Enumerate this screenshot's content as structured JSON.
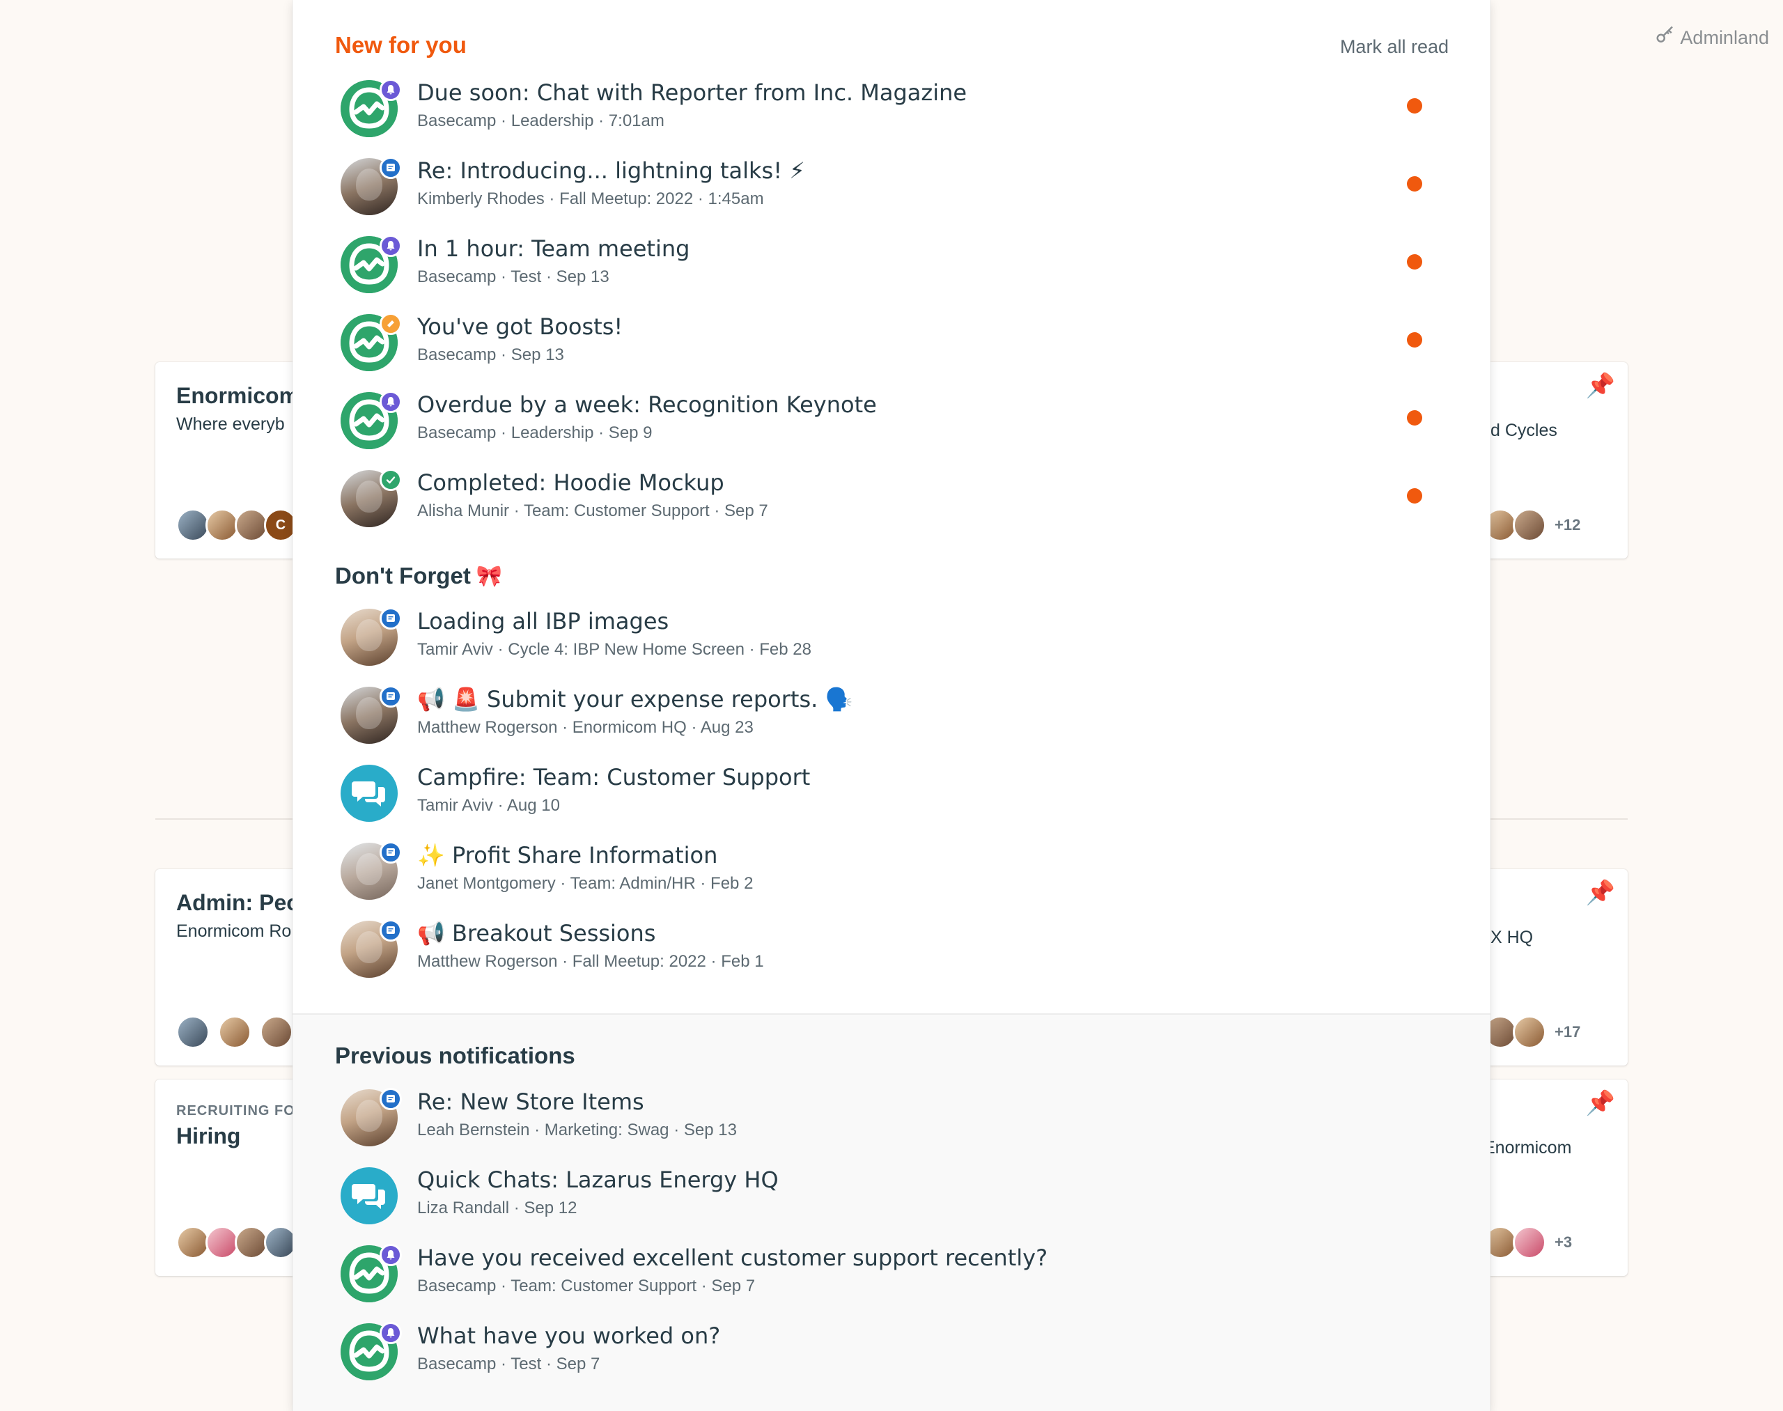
{
  "adminland": {
    "label": "Adminland",
    "icon": "key-icon"
  },
  "background_cards": {
    "card1": {
      "title": "Enormicom",
      "desc": "Where everyb",
      "avatar_initials": "C"
    },
    "card2": {
      "desc": "d Cycles",
      "extra": "+12"
    },
    "card3": {
      "title": "Admin: Peo",
      "desc": "Enormicom Ro"
    },
    "card4": {
      "desc": "X HQ",
      "extra": "+17"
    },
    "card5": {
      "eyebrow": "RECRUITING FO",
      "title": "Hiring"
    },
    "card6": {
      "desc": "Enormicom",
      "extra": "+3"
    }
  },
  "panel": {
    "new_heading": "New for you",
    "mark_all_read": "Mark all read",
    "new_items": [
      {
        "title": "Due soon: Chat with Reporter from Inc. Magazine",
        "meta": "Basecamp · Leadership · 7:01am",
        "avatar": "basecamp",
        "badge": "bell-icon",
        "unread": true
      },
      {
        "title": "Re: Introducing... lightning talks! ⚡",
        "meta": "Kimberly Rhodes · Fall Meetup: 2022 · 1:45am",
        "avatar": "person",
        "badge": "message-icon",
        "unread": true
      },
      {
        "title": "In 1 hour: Team meeting",
        "meta": "Basecamp · Test · Sep 13",
        "avatar": "basecamp",
        "badge": "bell-icon",
        "unread": true
      },
      {
        "title": "You've got Boosts!",
        "meta": "Basecamp · Sep 13",
        "avatar": "basecamp",
        "badge": "boost-icon",
        "unread": true
      },
      {
        "title": "Overdue by a week: Recognition Keynote",
        "meta": "Basecamp · Leadership · Sep 9",
        "avatar": "basecamp",
        "badge": "bell-icon",
        "unread": true
      },
      {
        "title": "Completed: Hoodie Mockup",
        "meta": "Alisha Munir · Team: Customer Support · Sep 7",
        "avatar": "person",
        "badge": "check-icon",
        "unread": true
      }
    ],
    "dont_forget_heading": "Don't Forget",
    "dont_forget_items": [
      {
        "title": "Loading all IBP images",
        "meta": "Tamir Aviv · Cycle 4: IBP New Home Screen · Feb 28",
        "avatar": "person",
        "badge": "message-icon"
      },
      {
        "title": "📢 🚨 Submit your expense reports. 🗣️",
        "meta": "Matthew Rogerson · Enormicom HQ · Aug 23",
        "avatar": "person",
        "badge": "message-icon"
      },
      {
        "title": "Campfire: Team: Customer Support",
        "meta": "Tamir Aviv · Aug 10",
        "avatar": "campfire"
      },
      {
        "title": "✨ Profit Share Information",
        "meta": "Janet Montgomery · Team: Admin/HR · Feb 2",
        "avatar": "person",
        "badge": "message-icon"
      },
      {
        "title": "📢 Breakout Sessions",
        "meta": "Matthew Rogerson · Fall Meetup: 2022 · Feb 1",
        "avatar": "person",
        "badge": "message-icon"
      }
    ],
    "previous_heading": "Previous notifications",
    "previous_items": [
      {
        "title": "Re: New Store Items",
        "meta": "Leah Bernstein · Marketing: Swag · Sep 13",
        "avatar": "person",
        "badge": "message-icon"
      },
      {
        "title": "Quick Chats: Lazarus Energy HQ",
        "meta": "Liza Randall · Sep 12",
        "avatar": "campfire"
      },
      {
        "title": "Have you received excellent customer support recently?",
        "meta": "Basecamp · Team: Customer Support · Sep 7",
        "avatar": "basecamp",
        "badge": "bell-icon"
      },
      {
        "title": "What have you worked on?",
        "meta": "Basecamp · Test · Sep 7",
        "avatar": "basecamp",
        "badge": "bell-icon"
      }
    ]
  },
  "colors": {
    "accent_orange": "#f0590e",
    "basecamp_green": "#2ea56b",
    "campfire_teal": "#29acc9",
    "badge_purple": "#6b5ad6",
    "badge_blue": "#2370c9"
  }
}
